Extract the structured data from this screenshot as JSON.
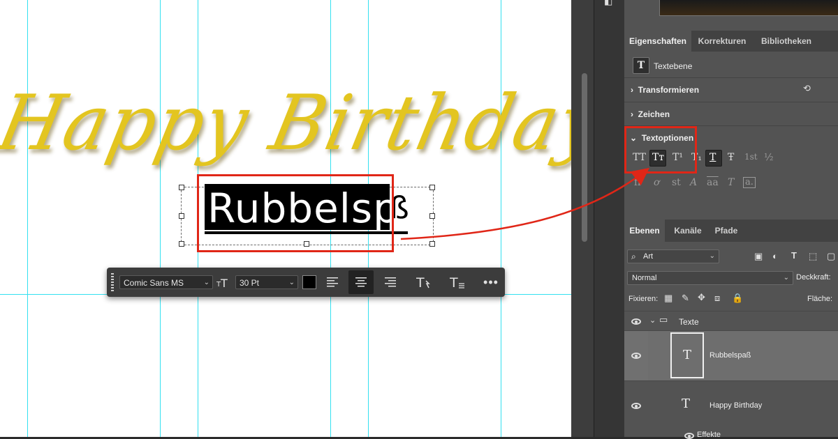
{
  "canvas": {
    "headline": "Happy Birthday",
    "selected_word_main": "Rubbelspa",
    "selected_word_tail": "ß"
  },
  "toolbar": {
    "font_family": "Comic Sans MS",
    "font_size": "30 Pt",
    "color": "#000000",
    "icons": [
      "font-size-icon",
      "align-left-icon",
      "align-center-icon",
      "align-right-icon",
      "warp-text-icon",
      "text-options-icon",
      "more-icon"
    ]
  },
  "properties": {
    "tabs": [
      "Eigenschaften",
      "Korrekturen",
      "Bibliotheken"
    ],
    "layer_type": "Textebene",
    "sections": {
      "transform": "Transformieren",
      "character": "Zeichen",
      "text_options": "Textoptionen"
    },
    "text_option_glyphs_row1": [
      "TT",
      "Tт",
      "T¹",
      "T₁",
      "T",
      "Ŧ",
      "1st",
      "½"
    ],
    "text_option_glyphs_row2": [
      "ﬁ",
      "ơ",
      "st",
      "A",
      "aa",
      "T",
      "a."
    ]
  },
  "layers": {
    "tabs": [
      "Ebenen",
      "Kanäle",
      "Pfade"
    ],
    "filter": "Art",
    "blend_mode": "Normal",
    "opacity_label": "Deckkraft:",
    "lock_label": "Fixieren:",
    "fill_label": "Fläche:",
    "group_name": "Texte",
    "items": [
      {
        "name": "Rubbelspaß",
        "thumb": "T"
      },
      {
        "name": "Happy Birthday",
        "thumb": "T"
      }
    ],
    "effects_label": "Effekte"
  },
  "colors": {
    "accent_red": "#e02617",
    "guide_cyan": "#33e0f0",
    "headline_yellow": "#e3c520"
  }
}
